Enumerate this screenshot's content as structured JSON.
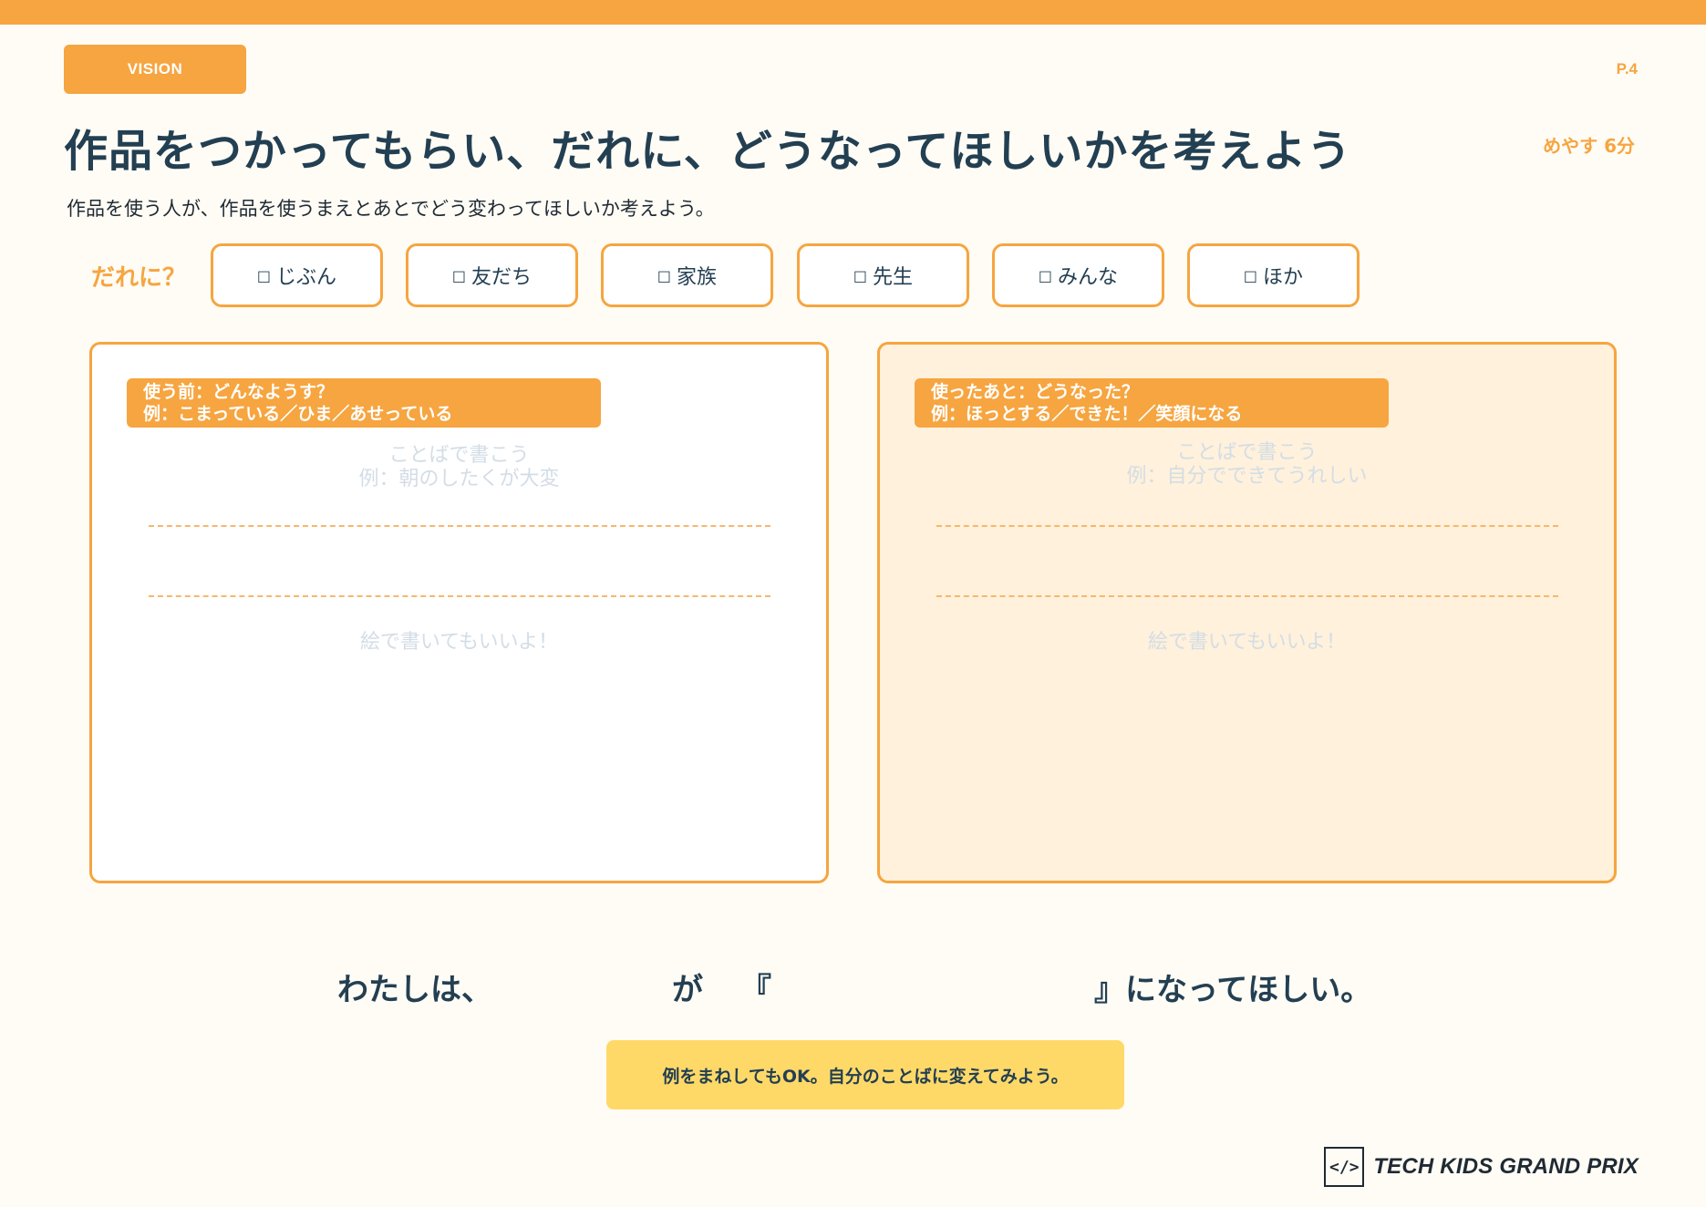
{
  "header": {
    "badge": "VISION",
    "page_number": "P.4",
    "title": "作品をつかってもらい、だれに、どうなってほしいかを考えよう",
    "time_estimate": "めやす 6分",
    "subtitle": "作品を使う人が、作品を使うまえとあとでどう変わってほしいか考えよう。"
  },
  "who": {
    "label": "だれに？",
    "checkbox_glyph": "□",
    "options": [
      "じぶん",
      "友だち",
      "家族",
      "先生",
      "みんな",
      "ほか"
    ]
  },
  "before_panel": {
    "tag_line1": "使う前：どんなようす？",
    "tag_line2": "例：こまっている／ひま／あせっている",
    "hint_line1": "ことばで書こう",
    "hint_line2": "例：朝のしたくが大変",
    "draw_hint": "絵で書いてもいいよ！"
  },
  "after_panel": {
    "tag_line1": "使ったあと：どうなった？",
    "tag_line2": "例：ほっとする／できた！／笑顔になる",
    "hint_line1": "ことばで書こう",
    "hint_line2": "例：自分でできてうれしい",
    "draw_hint": "絵で書いてもいいよ！"
  },
  "sentence": {
    "part1": "わたしは、",
    "part2": "が",
    "open_bracket": "『",
    "close": "』になってほしい。"
  },
  "tip": "例をまねしてもOK。自分のことばに変えてみよう。",
  "logo": {
    "icon": "</>",
    "text": "TECH KIDS GRAND PRIX"
  },
  "colors": {
    "accent": "#f6a540",
    "text": "#233f52",
    "background": "#fffcf5",
    "after_panel_fill": "#fff1db",
    "tip_fill": "#ffd968"
  }
}
